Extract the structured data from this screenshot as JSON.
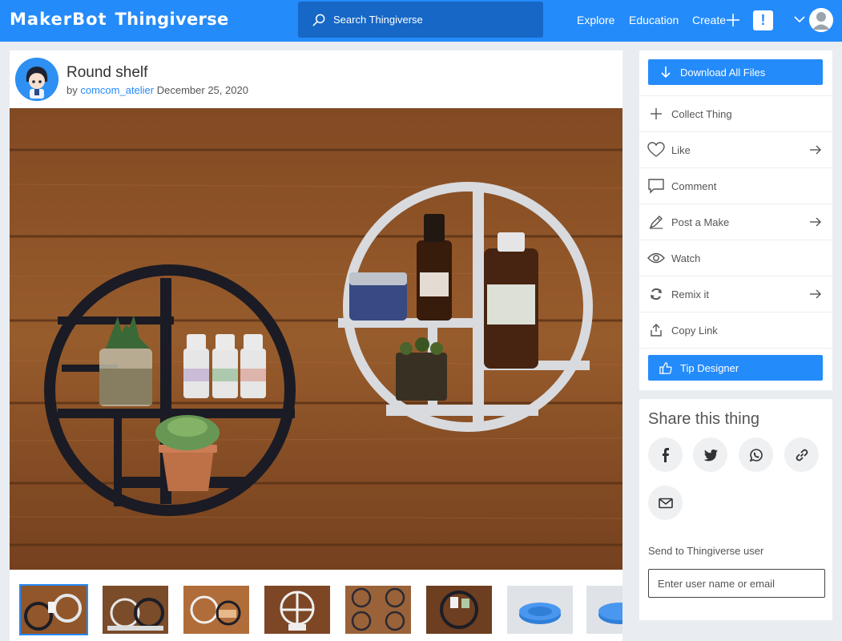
{
  "header": {
    "logo_maker": "MakerBot",
    "logo_name": "Thingiverse",
    "search_placeholder": "Search Thingiverse",
    "nav": [
      "Explore",
      "Education",
      "Create"
    ],
    "notification_glyph": "!",
    "brand_color": "#248bfb"
  },
  "thing": {
    "title": "Round shelf",
    "by_prefix": "by",
    "author": "comcom_atelier",
    "date": "December 25, 2020"
  },
  "gallery": {
    "thumbnail_count": 8,
    "active_index": 0
  },
  "actions": {
    "download_label": "Download All Files",
    "rows": [
      {
        "label": "Collect Thing",
        "icon": "plus-icon",
        "has_arrow": false
      },
      {
        "label": "Like",
        "icon": "heart-icon",
        "has_arrow": true
      },
      {
        "label": "Comment",
        "icon": "comment-icon",
        "has_arrow": false
      },
      {
        "label": "Post a Make",
        "icon": "pencil-icon",
        "has_arrow": true
      },
      {
        "label": "Watch",
        "icon": "eye-icon",
        "has_arrow": false
      },
      {
        "label": "Remix it",
        "icon": "remix-icon",
        "has_arrow": true
      },
      {
        "label": "Copy Link",
        "icon": "share-icon",
        "has_arrow": false
      }
    ],
    "tip_label": "Tip Designer"
  },
  "share": {
    "title": "Share this thing",
    "networks": [
      "facebook-icon",
      "twitter-icon",
      "whatsapp-icon",
      "link-icon",
      "email-icon"
    ],
    "send_label": "Send to Thingiverse user",
    "send_placeholder": "Enter user name or email"
  }
}
